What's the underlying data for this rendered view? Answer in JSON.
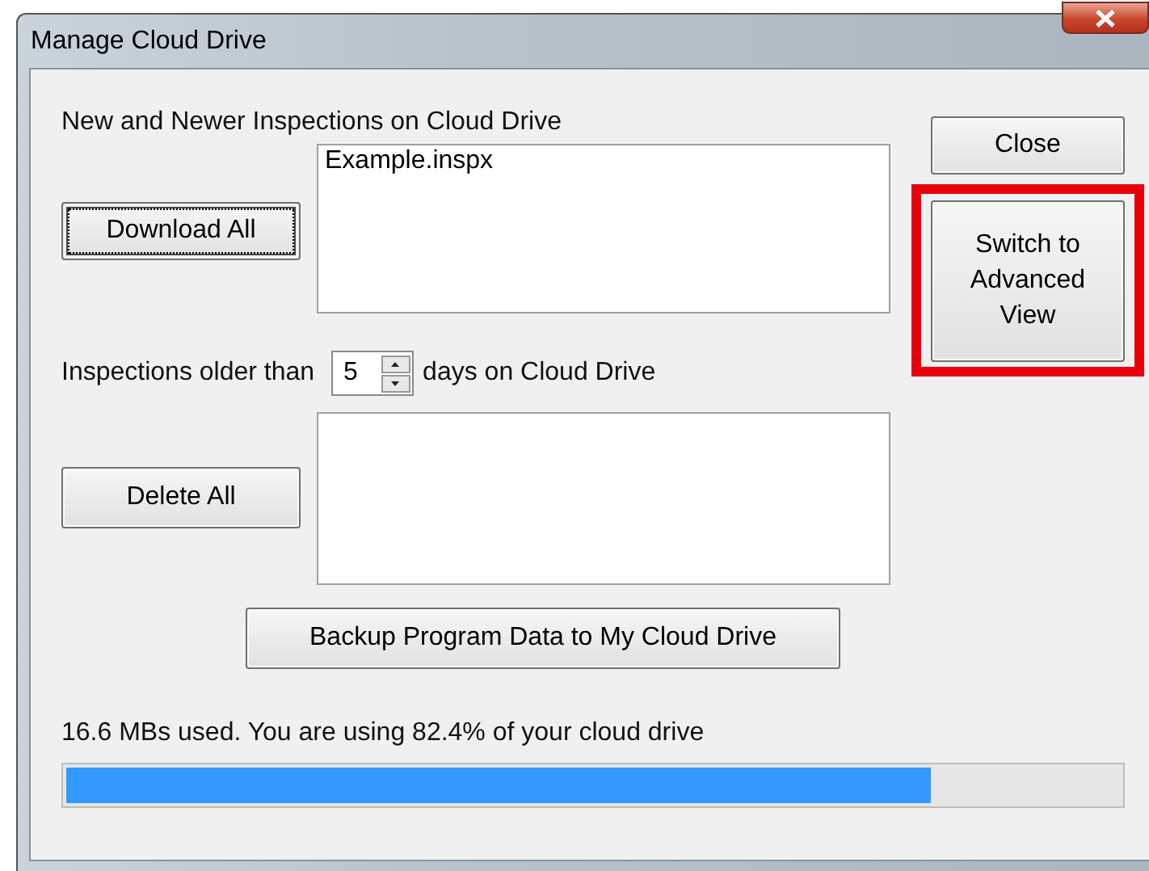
{
  "window": {
    "title": "Manage Cloud Drive"
  },
  "new_inspections": {
    "label": "New and Newer Inspections on Cloud Drive",
    "button": {
      "label": "Download All",
      "focused": true
    },
    "items": [
      "Example.inspx"
    ]
  },
  "old_inspections": {
    "label_before": "Inspections older than",
    "days": "5",
    "label_after": "days on Cloud Drive",
    "button": {
      "label": "Delete All",
      "focused": false
    }
  },
  "backup_button": "Backup Program Data to My Cloud Drive",
  "side_buttons": [
    {
      "label": "Close",
      "highlighted": false
    },
    {
      "label": "Switch to Advanced View",
      "highlighted": true
    }
  ],
  "usage": {
    "text": "16.6 MBs used. You are using 82.4% of your cloud drive",
    "level": 0.82
  }
}
